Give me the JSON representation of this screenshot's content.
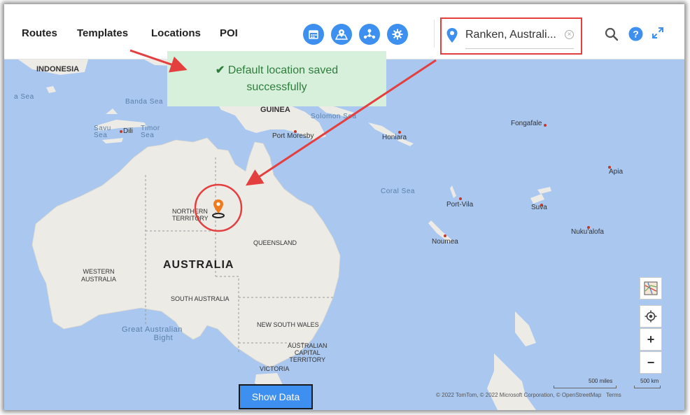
{
  "nav": {
    "routes": "Routes",
    "templates": "Templates",
    "locations": "Locations",
    "poi": "POI"
  },
  "toolbar_icons": [
    "calendar-icon",
    "map-pin-icon",
    "users-network-icon",
    "gear-icon"
  ],
  "search": {
    "value": "Ranken, Australi..."
  },
  "toast": {
    "message_line1": "Default location saved",
    "message_line2": "successfully"
  },
  "map": {
    "labels": {
      "indonesia": "INDONESIA",
      "guinea": "GUINEA",
      "australia": "AUSTRALIA",
      "northern_territory_1": "NORTHERN",
      "northern_territory_2": "TERRITORY",
      "queensland": "QUEENSLAND",
      "western_australia_1": "WESTERN",
      "western_australia_2": "AUSTRALIA",
      "south_australia": "SOUTH AUSTRALIA",
      "new_south_wales": "NEW SOUTH WALES",
      "act_1": "AUSTRALIAN",
      "act_2": "CAPITAL",
      "act_3": "TERRITORY",
      "victoria": "VICTORIA",
      "dili": "Dili",
      "port_moresby": "Port Moresby",
      "honiara": "Honiara",
      "fongafale": "Fongafale",
      "apia": "Apia",
      "port_vila": "Port-Vila",
      "suva": "Suva",
      "nukualofa": "Nuku'alofa",
      "noumea": "Noumea"
    },
    "seas": {
      "banda_sea": "Banda Sea",
      "a_sea": "a Sea",
      "savu_sea_1": "Savu",
      "savu_sea_2": "Sea",
      "timor_sea_1": "Timor",
      "timor_sea_2": "Sea",
      "solomon_sea": "Solomon Sea",
      "coral_sea": "Coral Sea",
      "bight_1": "Great Australian",
      "bight_2": "Bight"
    },
    "scale_miles": "500 miles",
    "scale_km": "500 km",
    "attribution": "© 2022 TomTom, © 2022 Microsoft Corporation, © OpenStreetMap",
    "terms": "Terms"
  },
  "controls": {
    "zoom_in": "+",
    "zoom_out": "−"
  },
  "show_data": "Show Data",
  "colors": {
    "accent": "#3d8ff0",
    "annotation": "#e43f3f",
    "toast_bg": "#d7f0db",
    "toast_text": "#2f7d3c",
    "marker": "#f07a1e"
  }
}
